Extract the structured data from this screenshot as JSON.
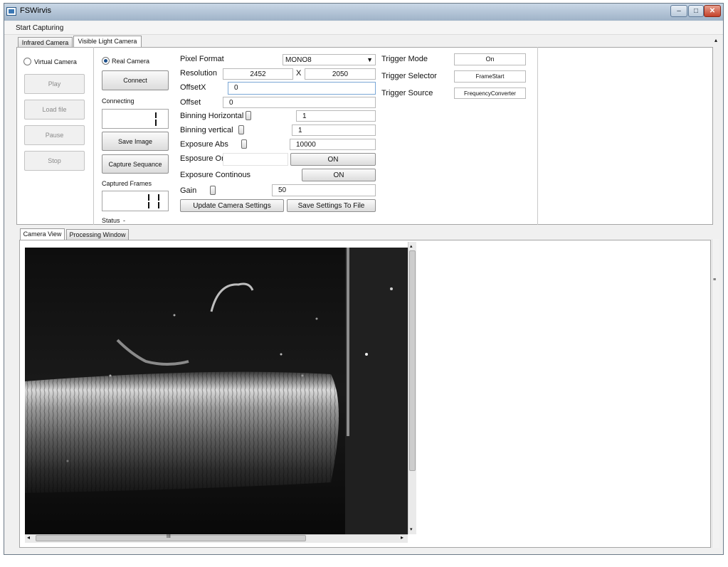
{
  "window": {
    "title": "FSWirvis",
    "minimize": "–",
    "maximize": "□",
    "close": "✕"
  },
  "menu": {
    "start_capturing": "Start Capturing"
  },
  "top_tabs": [
    "Infrared Camera",
    "Visible Light Camera"
  ],
  "left_controls": {
    "virtual_camera": "Virtual Camera",
    "play": "Play",
    "load_file": "Load file",
    "pause": "Pause",
    "stop": "Stop"
  },
  "mid_controls": {
    "real_camera": "Real Camera",
    "connect": "Connect",
    "connecting_label": "Connecting",
    "save_image": "Save Image",
    "capture_sequence": "Capture Sequance",
    "captured_frames_label": "Captured Frames",
    "status_label": "Status",
    "status_value": "-"
  },
  "settings": {
    "pixel_format_label": "Pixel Format",
    "pixel_format_value": "MONO8",
    "resolution_label": "Resolution",
    "resolution_width": "2452",
    "resolution_x": "X",
    "resolution_height": "2050",
    "offset_x_label": "OffsetX",
    "offset_x_value": "0",
    "offset_label": "Offset",
    "offset_value": "0",
    "binning_horizontal_label": "Binning Horizontal",
    "binning_horizontal_value": "1",
    "binning_vertical_label": "Binning vertical",
    "binning_vertical_value": "1",
    "exposure_abs_label": "Exposure Abs",
    "exposure_abs_value": "10000",
    "exposure_once_label": "Esposure Once",
    "exposure_once_button": "ON",
    "exposure_continuous_label": "Exposure Continous",
    "exposure_continuous_button": "ON",
    "gain_label": "Gain",
    "gain_value": "50",
    "update_button": "Update Camera Settings",
    "save_settings_button": "Save Settings To File"
  },
  "trigger": {
    "mode_label": "Trigger Mode",
    "mode_value": "On",
    "selector_label": "Trigger Selector",
    "selector_value": "FrameStart",
    "source_label": "Trigger Source",
    "source_value": "FrequencyConverter"
  },
  "view_tabs": [
    "Camera View",
    "Processing Window"
  ],
  "scroll": {
    "up": "▴",
    "down": "▾",
    "left": "◂",
    "right": "▸",
    "grip": "III"
  }
}
